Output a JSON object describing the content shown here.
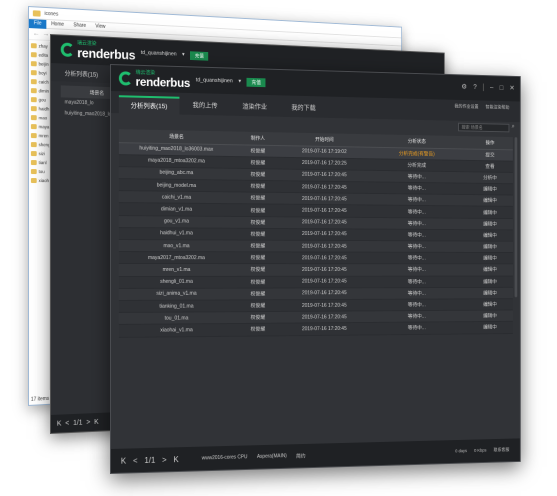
{
  "explorer": {
    "title": "icones",
    "ribbon_tabs": [
      "File",
      "Home",
      "Share",
      "View"
    ],
    "sidebar_items": [
      "zhay",
      "edita",
      "beijin",
      "boyi",
      "caich",
      "dimin",
      "gou",
      "haidh",
      "mao",
      "maya",
      "mren",
      "sheng",
      "sizi",
      "tianl",
      "tou",
      "xiaoh"
    ],
    "status": "17 items"
  },
  "mid": {
    "logo_cn": "瑞云渲染",
    "logo_en": "renderbus",
    "user": "td_quanshijinen",
    "plan_label": "充值",
    "tab": "分析列表(15)",
    "column": "场景名",
    "rows": [
      "maya2018_lo",
      "huiyiting_mao2018_lo"
    ],
    "pager": [
      "K",
      "<",
      "1/1",
      ">",
      "K"
    ]
  },
  "front": {
    "logo_cn": "瑞云渲染",
    "logo_en": "renderbus",
    "user": "td_quanshijinen",
    "plan_label": "充值",
    "tabs": [
      "分析列表(15)",
      "我的上传",
      "渲染作业",
      "我的下载"
    ],
    "links": [
      "我的作业设置",
      "智能渲染帮助"
    ],
    "search_placeholder": "搜索 场景名",
    "columns": [
      "场景名",
      "制作人",
      "开始时间",
      "分析状态",
      "操作"
    ],
    "rows": [
      {
        "name": "huiyiting_mao2018_lo36003.max",
        "owner": "权俊耀",
        "time": "2019-07-16 17:19:02",
        "status": "分析完成(有警告)",
        "warn": true,
        "op": "提交"
      },
      {
        "name": "maya2018_mtoa3202.ma",
        "owner": "权俊耀",
        "time": "2019-07-16 17:20:25",
        "status": "分析完成",
        "warn": false,
        "op": "查看"
      },
      {
        "name": "beijing_abc.ma",
        "owner": "权俊耀",
        "time": "2019-07-16 17:20:45",
        "status": "等待中...",
        "warn": false,
        "op": "分析中"
      },
      {
        "name": "beijing_model.ma",
        "owner": "权俊耀",
        "time": "2019-07-16 17:20:45",
        "status": "等待中...",
        "warn": false,
        "op": "编辑中"
      },
      {
        "name": "caichi_v1.ma",
        "owner": "权俊耀",
        "time": "2019-07-16 17:20:45",
        "status": "等待中...",
        "warn": false,
        "op": "编辑中"
      },
      {
        "name": "dimian_v1.ma",
        "owner": "权俊耀",
        "time": "2019-07-16 17:20:45",
        "status": "等待中...",
        "warn": false,
        "op": "编辑中"
      },
      {
        "name": "gou_v1.ma",
        "owner": "权俊耀",
        "time": "2019-07-16 17:20:45",
        "status": "等待中...",
        "warn": false,
        "op": "编辑中"
      },
      {
        "name": "haidhui_v1.ma",
        "owner": "权俊耀",
        "time": "2019-07-16 17:20:45",
        "status": "等待中...",
        "warn": false,
        "op": "编辑中"
      },
      {
        "name": "mao_v1.ma",
        "owner": "权俊耀",
        "time": "2019-07-16 17:20:45",
        "status": "等待中...",
        "warn": false,
        "op": "编辑中"
      },
      {
        "name": "maya2017_mtoa3202.ma",
        "owner": "权俊耀",
        "time": "2019-07-16 17:20:45",
        "status": "等待中...",
        "warn": false,
        "op": "编辑中"
      },
      {
        "name": "mren_v1.ma",
        "owner": "权俊耀",
        "time": "2019-07-16 17:20:45",
        "status": "等待中...",
        "warn": false,
        "op": "编辑中"
      },
      {
        "name": "shengli_01.ma",
        "owner": "权俊耀",
        "time": "2019-07-16 17:20:45",
        "status": "等待中...",
        "warn": false,
        "op": "编辑中"
      },
      {
        "name": "sizi_anima_v1.ma",
        "owner": "权俊耀",
        "time": "2019-07-16 17:20:45",
        "status": "等待中...",
        "warn": false,
        "op": "编辑中"
      },
      {
        "name": "tianking_01.ma",
        "owner": "权俊耀",
        "time": "2019-07-16 17:20:45",
        "status": "等待中...",
        "warn": false,
        "op": "编辑中"
      },
      {
        "name": "tou_01.ma",
        "owner": "权俊耀",
        "time": "2019-07-16 17:20:45",
        "status": "等待中...",
        "warn": false,
        "op": "编辑中"
      },
      {
        "name": "xiaohai_v1.ma",
        "owner": "权俊耀",
        "time": "2019-07-16 17:20:45",
        "status": "等待中...",
        "warn": false,
        "op": "编辑中"
      }
    ],
    "pager": [
      "K",
      "<",
      "1/1",
      ">",
      "K"
    ],
    "footer_info": [
      "www2016-cores CPU",
      "Aspera(MAIN)",
      "简约"
    ],
    "footer_right": [
      "0 days",
      "0 Kbps",
      "联系客服"
    ]
  },
  "colors": {
    "accent": "#1fbd6e",
    "warning": "#f0a020",
    "panel": "#313337",
    "header": "#1f2124"
  }
}
